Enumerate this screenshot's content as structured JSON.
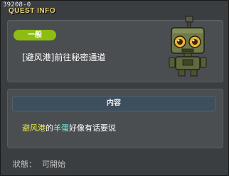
{
  "window": {
    "id_text": "39208-0",
    "title": "QUEST INFO"
  },
  "quest": {
    "category_badge": "一般",
    "name": "[避风港]前往秘密通道",
    "npc_portrait": "robot-npc-portrait"
  },
  "content": {
    "header": "内容",
    "description": {
      "part1": "避风港",
      "part2": "的",
      "part3": "羊蛋",
      "part4": "好像有话要说"
    }
  },
  "status": {
    "label": "狀態：",
    "value": "可開始"
  },
  "colors": {
    "badge": "#8ebd12",
    "title": "#e8d27a",
    "highlight_location": "#e8ea50",
    "highlight_npc": "#7ef0e8"
  }
}
